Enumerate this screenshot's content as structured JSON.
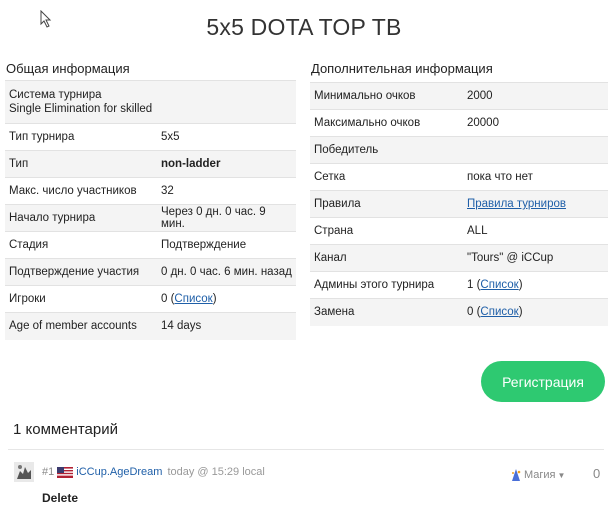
{
  "page": {
    "title": "5x5 DOTA TOP TB"
  },
  "general": {
    "heading": "Общая информация",
    "system_label": "Система турнира",
    "system_value": "Single Elimination for skilled",
    "rows": [
      {
        "label": "Тип турнира",
        "value": "5x5"
      },
      {
        "label": "Тип",
        "value": "non-ladder"
      },
      {
        "label": "Макс. число участников",
        "value": "32"
      },
      {
        "label": "Начало турнира",
        "value": "Через 0 дн. 0 час. 9 мин."
      },
      {
        "label": "Стадия",
        "value": "Подтверждение"
      },
      {
        "label": "Подтверждение участия",
        "value": "0 дн. 0 час. 6 мин. назад"
      },
      {
        "label": "Игроки",
        "value": "0 (",
        "link": "Список",
        "suffix": ")"
      },
      {
        "label": "Age of member accounts",
        "value": "14 days"
      }
    ]
  },
  "extra": {
    "heading": "Дополнительная информация",
    "rows": [
      {
        "label": "Минимально очков",
        "value": "2000"
      },
      {
        "label": "Максимально очков",
        "value": "20000"
      },
      {
        "label": "Победитель",
        "value": ""
      },
      {
        "label": "Сетка",
        "value": "пока что нет"
      },
      {
        "label": "Правила",
        "link": "Правила турниров"
      },
      {
        "label": "Страна",
        "value": "ALL"
      },
      {
        "label": "Канал",
        "value": "\"Tours\" @ iCCup"
      },
      {
        "label": "Админы этого турнира",
        "value": "1 (",
        "link": "Список",
        "suffix": ")"
      },
      {
        "label": "Замена",
        "value": "0 (",
        "link": "Список",
        "suffix": ")"
      }
    ]
  },
  "register_button": "Регистрация",
  "comments": {
    "title": "1 комментарий",
    "items": [
      {
        "number": "#1",
        "user": "iCCup.AgeDream",
        "time": "today @ 15:29 local",
        "reaction": "Магия",
        "votes": "0",
        "action": "Delete"
      }
    ]
  },
  "icons": [
    "cursor-icon",
    "avatar-icon",
    "us-flag-icon",
    "magic-icon",
    "caret-down-icon"
  ]
}
